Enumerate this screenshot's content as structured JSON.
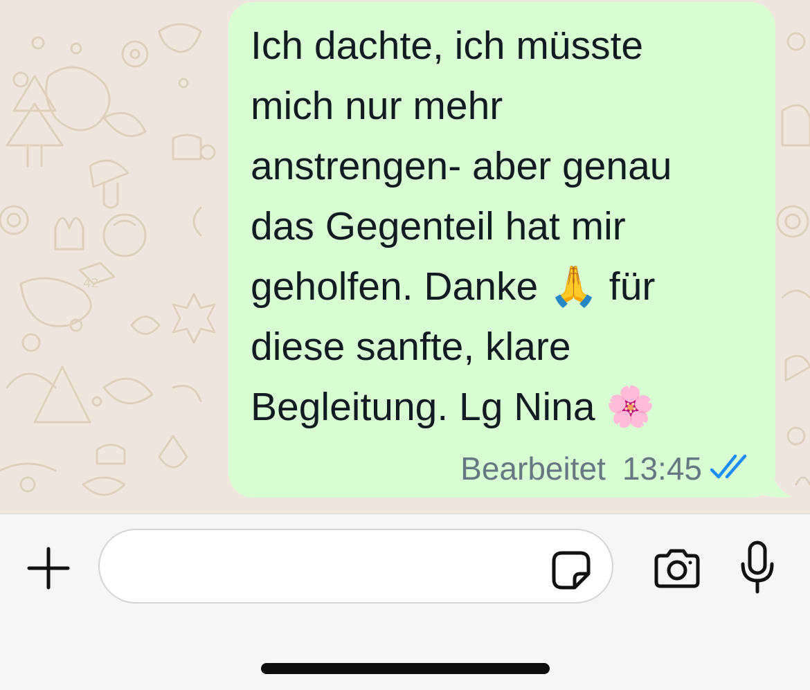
{
  "message": {
    "text": "Ich dachte, ich müsste\nmich nur mehr\nanstrengen- aber genau\ndas Gegenteil hat mir\ngeholfen. Danke 🙏 für\ndiese sanfte, klare\nBegleitung. Lg Nina 🌸",
    "edited_label": "Bearbeitet",
    "time": "13:45",
    "status_icon": "double-check-read-icon",
    "bubble_color": "#d9fdd3",
    "tick_color": "#1d8cf8"
  },
  "composer": {
    "input_value": "",
    "attach_icon": "plus-icon",
    "sticker_icon": "sticker-icon",
    "camera_icon": "camera-icon",
    "mic_icon": "microphone-icon"
  },
  "theme": {
    "wallpaper_color": "#efe7dd",
    "bar_color": "#f6f6f6"
  }
}
